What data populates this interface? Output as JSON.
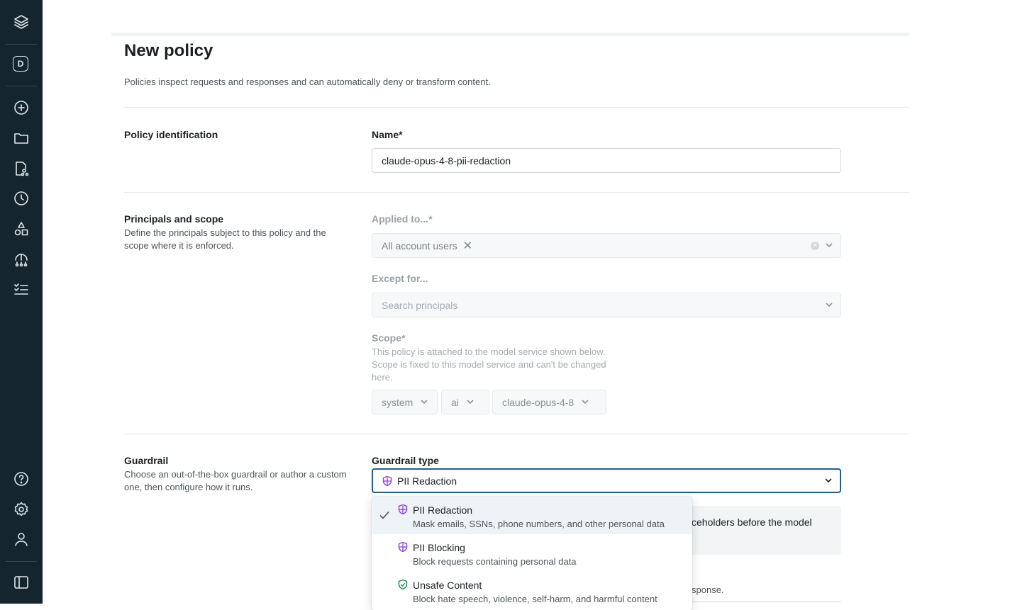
{
  "sidebar": {
    "workspace_badge": "D",
    "icons": [
      "layers-logo-icon",
      "add-circle-icon",
      "folder-icon",
      "file-tree-icon",
      "history-icon",
      "shapes-icon",
      "hierarchy-icon",
      "checklist-icon",
      "help-icon",
      "settings-icon",
      "user-icon",
      "panel-toggle-icon"
    ]
  },
  "page": {
    "title": "New policy",
    "subtitle": "Policies inspect requests and responses and can automatically deny or transform content."
  },
  "identification": {
    "section_title": "Policy identification",
    "name_label": "Name*",
    "name_value": "claude-opus-4-8-pii-redaction"
  },
  "principals": {
    "section_title": "Principals and scope",
    "section_desc": "Define the principals subject to this policy and the scope where it is enforced.",
    "applied_label": "Applied to...*",
    "applied_chip": "All account users",
    "except_label": "Except for...",
    "except_placeholder": "Search principals",
    "scope_label": "Scope*",
    "scope_desc": "This policy is attached to the model service shown below. Scope is fixed to this model service and can't be changed here.",
    "scope_values": [
      "system",
      "ai",
      "claude-opus-4-8"
    ]
  },
  "guardrail": {
    "section_title": "Guardrail",
    "section_desc": "Choose an out-of-the-box guardrail or author a custom one, then configure how it runs.",
    "type_label": "Guardrail type",
    "selected": "PII Redaction",
    "info_text": "ceholders before the model",
    "info_text2": "sponse.",
    "options": [
      {
        "name": "PII Redaction",
        "desc": "Mask emails, SSNs, phone numbers, and other personal data"
      },
      {
        "name": "PII Blocking",
        "desc": "Block requests containing personal data"
      },
      {
        "name": "Unsafe Content",
        "desc": "Block hate speech, violence, self-harm, and harmful content"
      }
    ]
  },
  "colors": {
    "sidebar_bg": "#15252d",
    "focus_border": "#1f5f8b",
    "pii_icon": "#8b3fd9",
    "unsafe_icon": "#1e8a4c"
  }
}
